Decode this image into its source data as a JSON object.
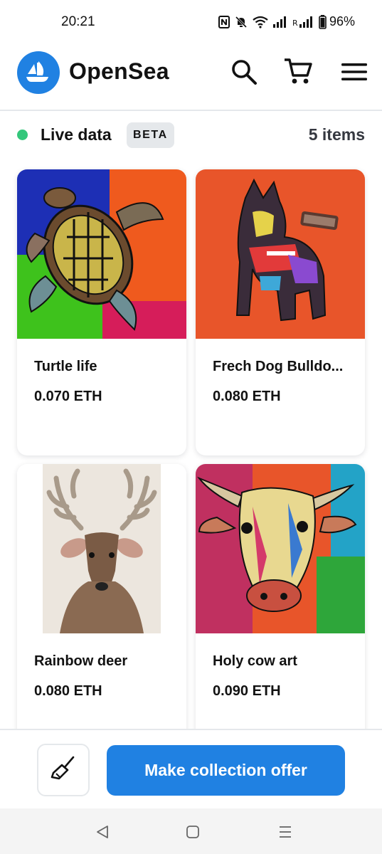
{
  "status_bar": {
    "time": "20:21",
    "battery": "96%",
    "icons": [
      "nfc-icon",
      "mute-icon",
      "wifi-icon",
      "signal-icon",
      "roaming-signal-icon",
      "battery-icon"
    ]
  },
  "header": {
    "brand": "OpenSea",
    "icons": [
      "opensea-logo-icon",
      "search-icon",
      "cart-icon",
      "menu-icon"
    ]
  },
  "live": {
    "label": "Live data",
    "badge": "BETA",
    "count": "5 items",
    "dot_color": "#34c77b"
  },
  "items": [
    {
      "name": "Turtle life",
      "price": "0.070 ETH"
    },
    {
      "name": "Frech Dog Bulldo...",
      "price": "0.080 ETH"
    },
    {
      "name": "Rainbow deer",
      "price": "0.080 ETH"
    },
    {
      "name": "Holy cow art",
      "price": "0.090 ETH"
    }
  ],
  "actions": {
    "sweep_icon": "broom-icon",
    "offer_label": "Make collection offer"
  },
  "colors": {
    "accent": "#2081e2",
    "border": "#e5e8eb"
  },
  "nav": [
    "back-icon",
    "home-icon",
    "recents-icon"
  ]
}
